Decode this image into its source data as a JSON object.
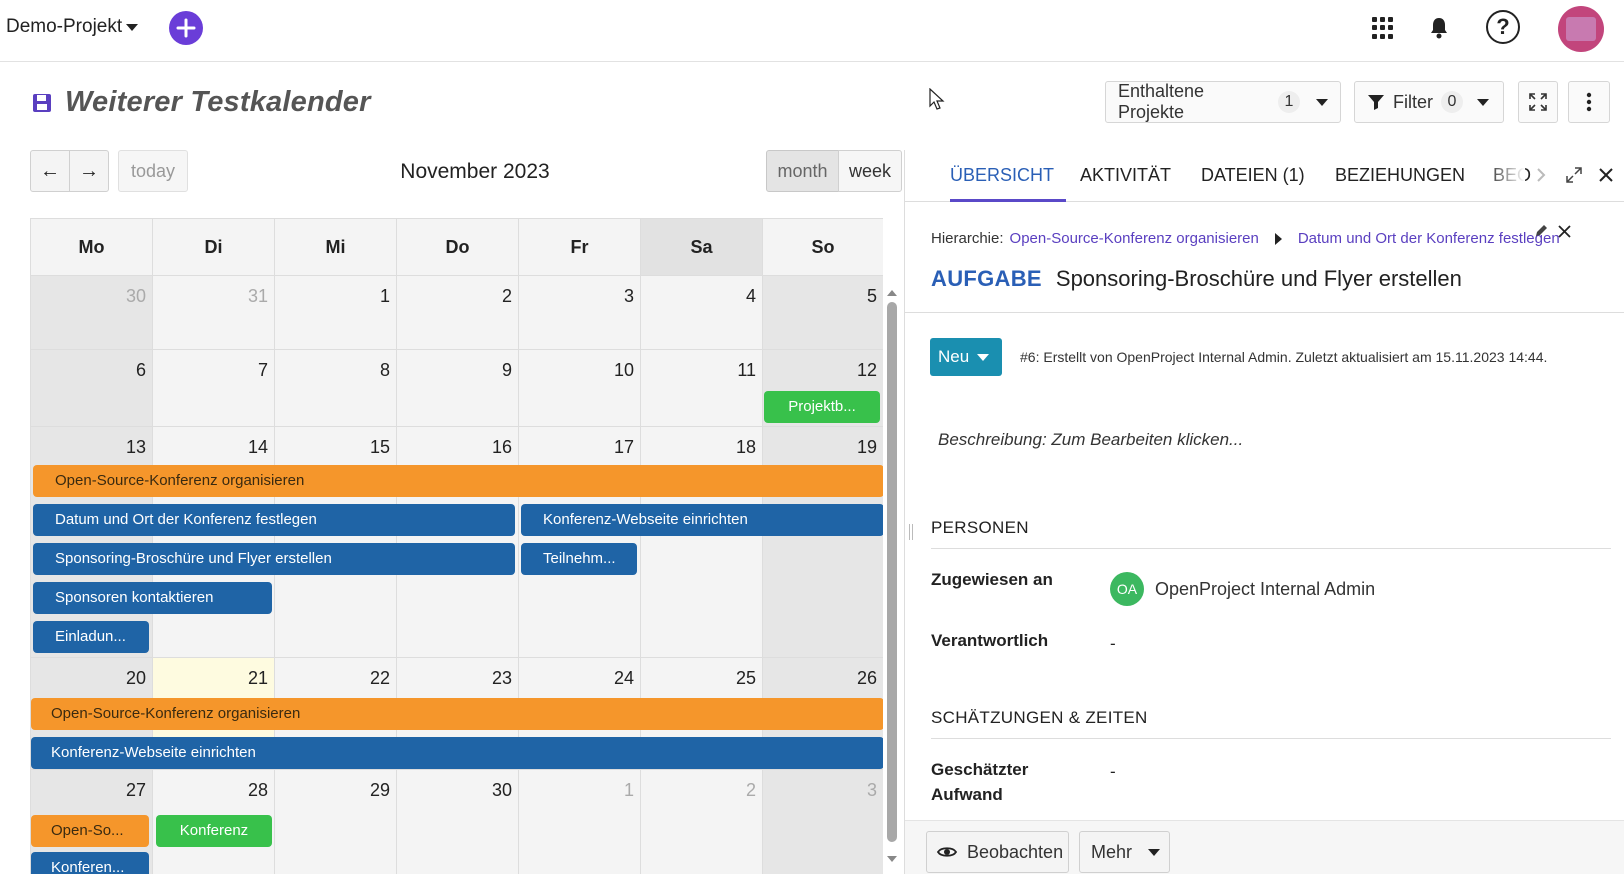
{
  "topbar": {
    "project": "Demo-Projekt",
    "icons": [
      "plus-icon",
      "grid-icon",
      "bell-icon",
      "help-icon",
      "avatar"
    ]
  },
  "header": {
    "title": "Weiterer Testkalender",
    "projects_label": "Enthaltene Projekte",
    "projects_count": "1",
    "filter_label": "Filter",
    "filter_count": "0"
  },
  "toolbar": {
    "today": "today",
    "month_title": "November 2023",
    "view_month": "month",
    "view_week": "week"
  },
  "calendar": {
    "weekdays": [
      "Mo",
      "Di",
      "Mi",
      "Do",
      "Fr",
      "Sa",
      "So"
    ],
    "weeks": [
      [
        "30",
        "31",
        "1",
        "2",
        "3",
        "4",
        "5"
      ],
      [
        "6",
        "7",
        "8",
        "9",
        "10",
        "11",
        "12"
      ],
      [
        "13",
        "14",
        "15",
        "16",
        "17",
        "18",
        "19"
      ],
      [
        "20",
        "21",
        "22",
        "23",
        "24",
        "25",
        "26"
      ],
      [
        "27",
        "28",
        "29",
        "30",
        "1",
        "2",
        "3"
      ]
    ],
    "events": {
      "w2_projektb": "Projektb...",
      "w3_osk": "Open-Source-Konferenz organisieren",
      "w3_datum": "Datum und Ort der Konferenz festlegen",
      "w3_webseite": "Konferenz-Webseite einrichten",
      "w3_sponsoring": "Sponsoring-Broschüre und Flyer erstellen",
      "w3_teilnehm": "Teilnehm...",
      "w3_sponsoren": "Sponsoren kontaktieren",
      "w3_einladun": "Einladun...",
      "w4_osk": "Open-Source-Konferenz organisieren",
      "w4_webseite": "Konferenz-Webseite einrichten",
      "w5_openso": "Open-So...",
      "w5_konferenz": "Konferenz",
      "w5_konferen": "Konferen..."
    },
    "colors": {
      "orange": "#f5962b",
      "blue": "#1f64a6",
      "green": "#38c14b",
      "today": "#fefbe0"
    }
  },
  "panel": {
    "tabs": [
      "ÜBERSICHT",
      "AKTIVITÄT",
      "DATEIEN (1)",
      "BEZIEHUNGEN",
      "BEO"
    ],
    "breadcrumb_label": "Hierarchie:",
    "breadcrumb_parent": "Open-Source-Konferenz organisieren",
    "breadcrumb_child": "Datum und Ort der Konferenz festlegen",
    "type": "AUFGABE",
    "subject": "Sponsoring-Broschüre und Flyer erstellen",
    "status": "Neu",
    "meta": "#6: Erstellt von OpenProject Internal Admin. Zuletzt aktualisiert am 15.11.2023 14:44.",
    "description": "Beschreibung: Zum Bearbeiten klicken...",
    "section_people": "PERSONEN",
    "assigned_label": "Zugewiesen an",
    "assignee_initials": "OA",
    "assignee_name": "OpenProject Internal Admin",
    "responsible_label": "Verantwortlich",
    "responsible_value": "-",
    "section_estimates": "SCHÄTZUNGEN & ZEITEN",
    "estimated_label_1": "Geschätzter",
    "estimated_label_2": "Aufwand",
    "estimated_value": "-",
    "watch": "Beobachten",
    "more": "Mehr"
  }
}
